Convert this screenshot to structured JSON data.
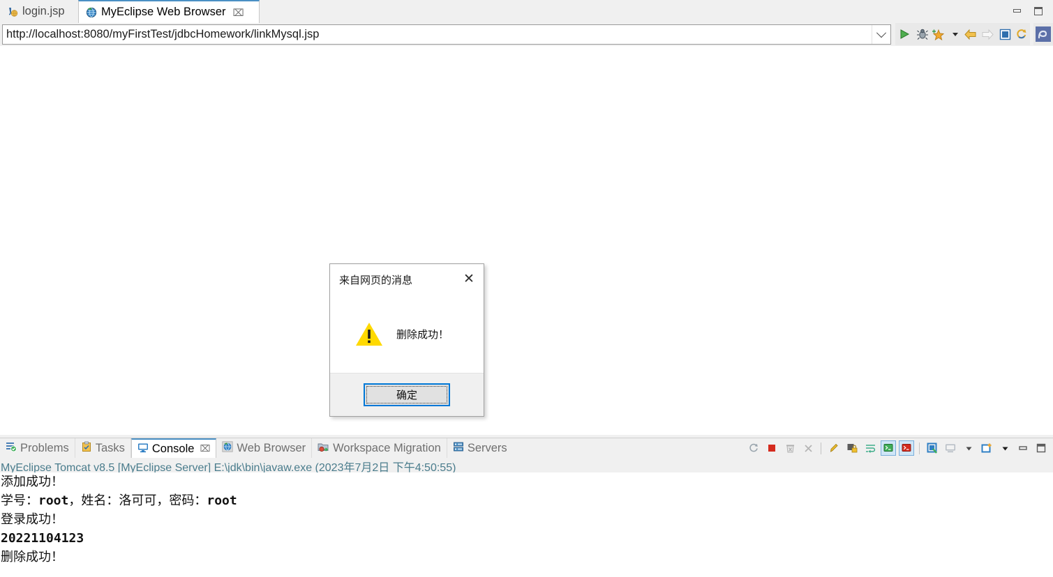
{
  "window": {
    "controls": [
      {
        "name": "minimize",
        "glyph": "minimize"
      },
      {
        "name": "maximize",
        "glyph": "maximize"
      }
    ]
  },
  "editor_tabs": [
    {
      "label": "login.jsp",
      "icon": "jsp-file-icon",
      "active": false,
      "closable": false
    },
    {
      "label": "MyEclipse Web Browser",
      "icon": "web-browser-icon",
      "active": true,
      "closable": true,
      "close_glyph": "⌧"
    }
  ],
  "url_bar": {
    "value": "http://localhost:8080/myFirstTest/jdbcHomework/linkMysql.jsp",
    "placeholder": "Enter URL",
    "dropdown_icon": "chevron-down-icon"
  },
  "browser_toolbar": {
    "groups": [
      {
        "name": "run-group",
        "buttons": [
          {
            "name": "run-icon",
            "title": "Run"
          },
          {
            "name": "debug-icon",
            "title": "Debug"
          }
        ]
      },
      {
        "name": "myeclipse-group",
        "buttons": [
          {
            "name": "myeclipse-star-icon",
            "title": "MyEclipse"
          },
          {
            "name": "dropdown-arrow-icon",
            "title": "More"
          }
        ]
      },
      {
        "name": "navigation-group",
        "buttons": [
          {
            "name": "back-arrow-icon",
            "title": "Back"
          },
          {
            "name": "forward-arrow-icon",
            "title": "Forward"
          },
          {
            "name": "stop-icon",
            "title": "Stop"
          },
          {
            "name": "refresh-icon",
            "title": "Refresh"
          }
        ]
      },
      {
        "name": "perspective-group",
        "buttons": [
          {
            "name": "myeclipse-perspective-icon",
            "title": "MyEclipse Java Enterprise"
          }
        ]
      }
    ]
  },
  "dialog": {
    "title": "来自网页的消息",
    "close_glyph": "✕",
    "close_name": "close-icon",
    "icon": "warning-triangle-icon",
    "message": "删除成功！",
    "ok_label": "确定",
    "accent_color": "#0078d7",
    "warning_color": "#ffd900"
  },
  "console_panel": {
    "tabs": [
      {
        "label": "Problems",
        "icon": "problems-icon",
        "active": false
      },
      {
        "label": "Tasks",
        "icon": "tasks-icon",
        "active": false
      },
      {
        "label": "Console",
        "icon": "console-icon",
        "active": true,
        "close_glyph": "⌧"
      },
      {
        "label": "Web Browser",
        "icon": "web-browser-icon",
        "active": false
      },
      {
        "label": "Workspace Migration",
        "icon": "workspace-migration-icon",
        "active": false
      },
      {
        "label": "Servers",
        "icon": "servers-icon",
        "active": false
      }
    ],
    "toolbar": [
      {
        "name": "refresh-icon",
        "title": "Refresh"
      },
      {
        "name": "terminate-icon",
        "title": "Terminate"
      },
      {
        "name": "remove-launch-icon",
        "title": "Remove Launch"
      },
      {
        "name": "remove-all-terminated-icon",
        "title": "Remove All Terminated Launches"
      },
      {
        "name": "clear-console-icon",
        "title": "Clear Console"
      },
      {
        "name": "scroll-lock-icon",
        "title": "Scroll Lock"
      },
      {
        "name": "word-wrap-icon",
        "title": "Word Wrap"
      },
      {
        "name": "show-console-stdout-icon",
        "title": "Show Console When Standard Out Changes",
        "boxed": true
      },
      {
        "name": "show-console-stderr-icon",
        "title": "Show Console When Standard Error Changes",
        "boxed": true
      },
      {
        "name": "pin-console-icon",
        "title": "Pin Console"
      },
      {
        "name": "display-selected-console-icon",
        "title": "Display Selected Console"
      },
      {
        "name": "display-selected-console-dropdown-icon",
        "title": "Display Selected Console Menu"
      },
      {
        "name": "open-console-icon",
        "title": "Open Console"
      },
      {
        "name": "open-console-dropdown-icon",
        "title": "Open Console Menu"
      },
      {
        "name": "minimize-panel-icon",
        "title": "Minimize"
      },
      {
        "name": "maximize-panel-icon",
        "title": "Maximize"
      }
    ],
    "header": "MyEclipse Tomcat v8.5 [MyEclipse Server] E:\\jdk\\bin\\javaw.exe (2023年7月2日 下午4:50:55)",
    "output": [
      {
        "text": "添加成功！",
        "mono": false
      },
      {
        "text": "学号：root，姓名：洛可可，密码：root",
        "mono": false,
        "mixed": true
      },
      {
        "text": "登录成功！",
        "mono": false
      },
      {
        "text": "20221104123",
        "mono": true
      },
      {
        "text": "删除成功！",
        "mono": false
      }
    ]
  }
}
